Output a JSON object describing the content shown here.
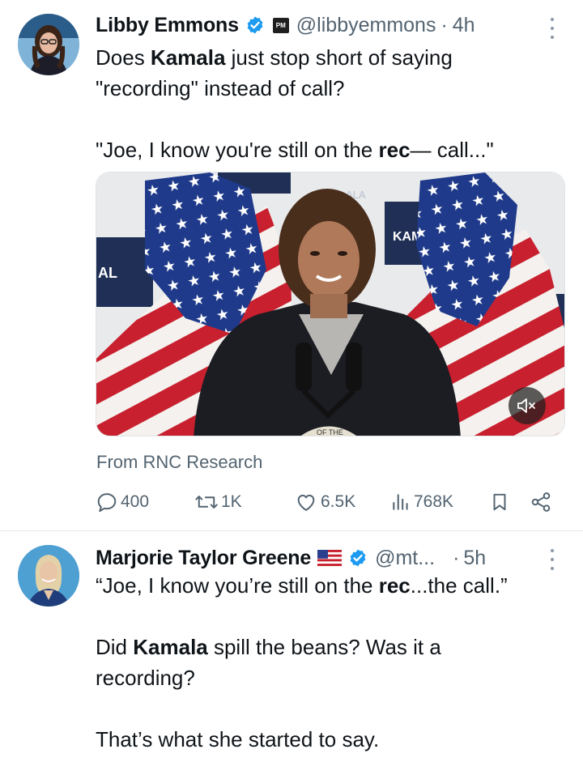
{
  "tweets": [
    {
      "author": "Libby Emmons",
      "handle": "@libbyemmons",
      "time": "4h",
      "pm_badge": "PM",
      "body_lines": [
        [
          {
            "t": "Does "
          },
          {
            "t": "Kamala",
            "b": true
          },
          {
            "t": " just stop short of saying"
          }
        ],
        [
          {
            "t": "\"recording\" instead of call?"
          }
        ],
        [],
        [
          {
            "t": "\"Joe, I know you're still on the "
          },
          {
            "t": "rec",
            "b": true
          },
          {
            "t": "— call...\""
          }
        ]
      ],
      "media": {
        "banner_left": "AL",
        "banner_right": "KAM",
        "banner_top": "ALA",
        "seal_text": "OF THE"
      },
      "source": "From RNC Research",
      "actions": {
        "replies": "400",
        "reposts": "1K",
        "likes": "6.5K",
        "views": "768K"
      }
    },
    {
      "author": "Marjorie Taylor Greene",
      "handle": "@mt...",
      "time": "5h",
      "body_lines": [
        [
          {
            "t": "“Joe, I know you’re still on the "
          },
          {
            "t": "rec",
            "b": true
          },
          {
            "t": "...the call.”"
          }
        ],
        [],
        [
          {
            "t": "Did "
          },
          {
            "t": "Kamala",
            "b": true
          },
          {
            "t": " spill the beans? Was it a"
          }
        ],
        [
          {
            "t": "recording?"
          }
        ],
        [],
        [
          {
            "t": "That’s what she started to say."
          }
        ]
      ]
    }
  ],
  "colors": {
    "text": "#0f1419",
    "secondary": "#536471",
    "verified": "#1d9bf0",
    "divider": "#e6e8ea"
  },
  "icons": [
    "verified-icon",
    "more-icon",
    "reply-icon",
    "repost-icon",
    "like-icon",
    "views-icon",
    "bookmark-icon",
    "share-icon",
    "mute-icon",
    "us-flag-icon"
  ]
}
